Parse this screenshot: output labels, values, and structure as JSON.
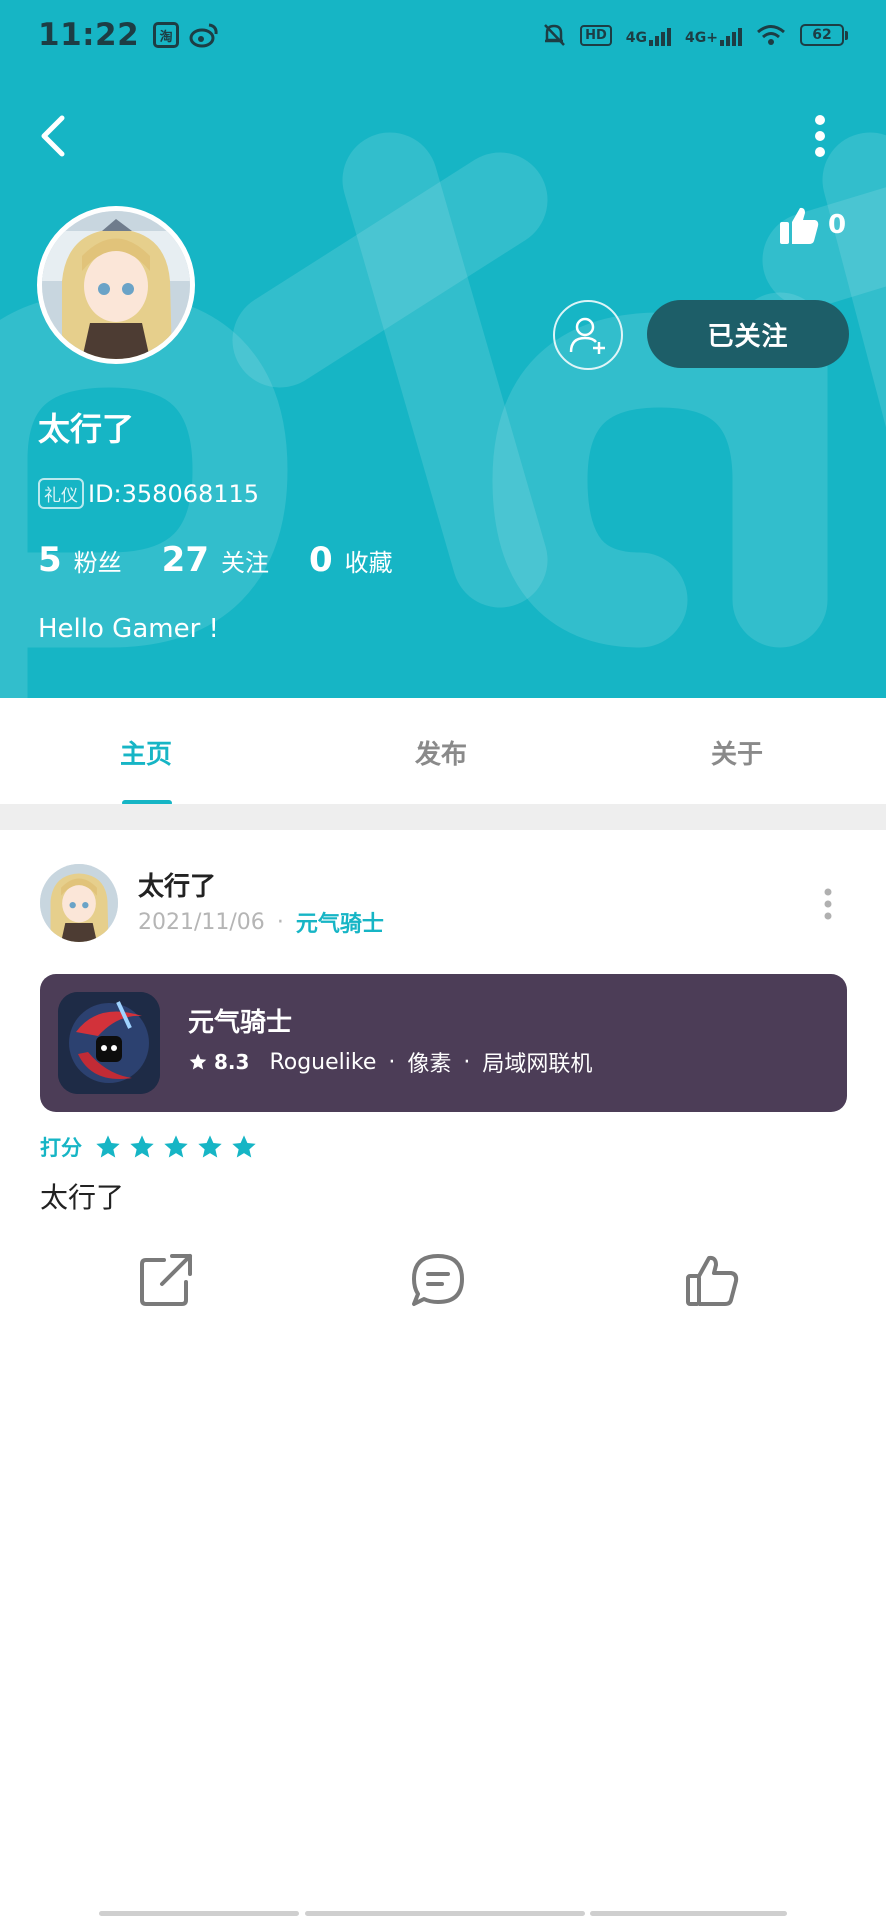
{
  "status_bar": {
    "time": "11:22",
    "app_badge_1": "淘",
    "hd": "HD",
    "network_1": "4G",
    "network_2": "4G+",
    "battery": "62"
  },
  "header": {
    "like_count": "0",
    "follow_button": "已关注",
    "username": "太行了",
    "badge": "礼仪",
    "id_text": "ID:358068115",
    "stats": [
      {
        "num": "5",
        "label": "粉丝"
      },
      {
        "num": "27",
        "label": "关注"
      },
      {
        "num": "0",
        "label": "收藏"
      }
    ],
    "bio": "Hello Gamer !"
  },
  "tabs": [
    {
      "label": "主页",
      "active": true
    },
    {
      "label": "发布",
      "active": false
    },
    {
      "label": "关于",
      "active": false
    }
  ],
  "post": {
    "author": "太行了",
    "date": "2021/11/06",
    "dot": "·",
    "game_tag": "元气骑士",
    "game_card": {
      "name": "元气骑士",
      "rating": "8.3",
      "tags": [
        "Roguelike",
        "像素",
        "局域网联机"
      ]
    },
    "score_label": "打分",
    "score_stars": 5,
    "review": "太行了"
  },
  "colors": {
    "accent": "#16b5c5",
    "follow_bg": "#1d5e68",
    "card_bg": "#4c3d57"
  }
}
